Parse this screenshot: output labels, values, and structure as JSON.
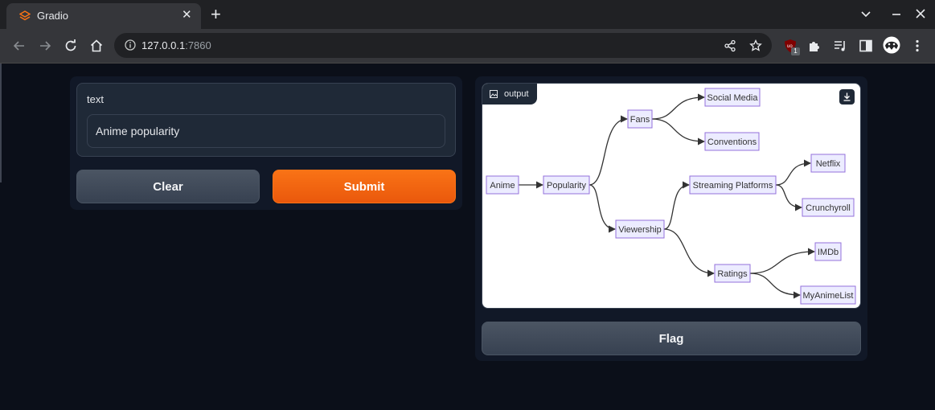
{
  "browser": {
    "tab_title": "Gradio",
    "url_host": "127.0.0.1",
    "url_port": ":7860",
    "extension_badge": "1"
  },
  "input": {
    "label": "text",
    "value": "Anime popularity"
  },
  "buttons": {
    "clear": "Clear",
    "submit": "Submit",
    "flag": "Flag"
  },
  "output": {
    "label": "output",
    "diagram": {
      "nodes": [
        {
          "id": "anime",
          "label": "Anime"
        },
        {
          "id": "popularity",
          "label": "Popularity"
        },
        {
          "id": "fans",
          "label": "Fans"
        },
        {
          "id": "viewership",
          "label": "Viewership"
        },
        {
          "id": "social",
          "label": "Social Media"
        },
        {
          "id": "conventions",
          "label": "Conventions"
        },
        {
          "id": "streaming",
          "label": "Streaming Platforms"
        },
        {
          "id": "netflix",
          "label": "Netflix"
        },
        {
          "id": "crunchyroll",
          "label": "Crunchyroll"
        },
        {
          "id": "ratings",
          "label": "Ratings"
        },
        {
          "id": "imdb",
          "label": "IMDb"
        },
        {
          "id": "mal",
          "label": "MyAnimeList"
        }
      ],
      "edges": [
        [
          "anime",
          "popularity"
        ],
        [
          "popularity",
          "fans"
        ],
        [
          "popularity",
          "viewership"
        ],
        [
          "fans",
          "social"
        ],
        [
          "fans",
          "conventions"
        ],
        [
          "viewership",
          "streaming"
        ],
        [
          "viewership",
          "ratings"
        ],
        [
          "streaming",
          "netflix"
        ],
        [
          "streaming",
          "crunchyroll"
        ],
        [
          "ratings",
          "imdb"
        ],
        [
          "ratings",
          "mal"
        ]
      ]
    }
  },
  "colors": {
    "accent": "#f97316",
    "page_bg": "#0b0f19",
    "node_fill": "#ececff",
    "node_stroke": "#9370db"
  }
}
